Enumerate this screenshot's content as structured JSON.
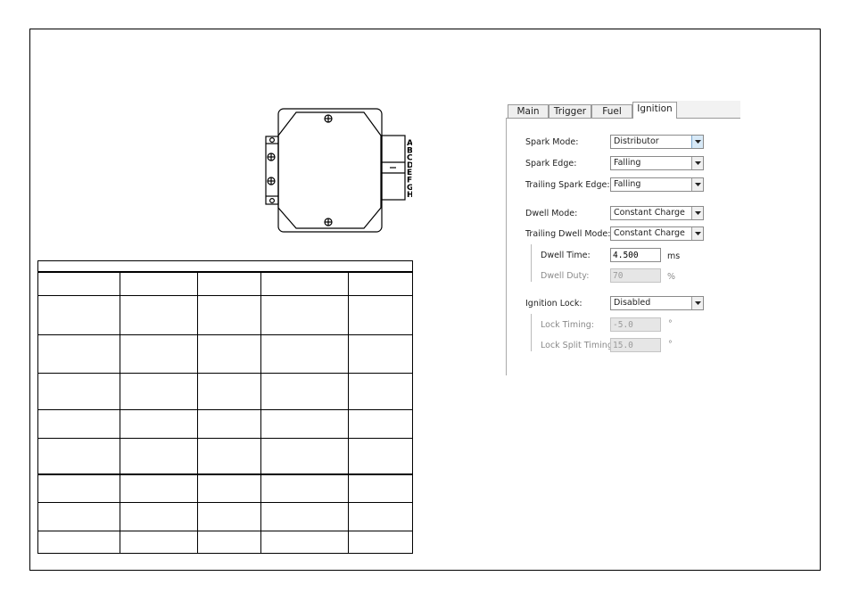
{
  "module": {
    "pin_letters": [
      "A",
      "B",
      "C",
      "D",
      "E",
      "F",
      "G",
      "H"
    ]
  },
  "pin_table": {
    "rows": 8,
    "cols": 5
  },
  "settings": {
    "tabs": [
      {
        "label": "Main"
      },
      {
        "label": "Trigger"
      },
      {
        "label": "Fuel"
      },
      {
        "label": "Ignition",
        "active": true
      }
    ],
    "spark_mode": {
      "label": "Spark Mode:",
      "value": "Distributor"
    },
    "spark_edge": {
      "label": "Spark Edge:",
      "value": "Falling"
    },
    "trailing_spark_edge": {
      "label": "Trailing Spark Edge:",
      "value": "Falling"
    },
    "dwell_mode": {
      "label": "Dwell Mode:",
      "value": "Constant Charge"
    },
    "trailing_dwell_mode": {
      "label": "Trailing Dwell Mode:",
      "value": "Constant Charge"
    },
    "dwell_time": {
      "label": "Dwell Time:",
      "value": "4.500",
      "unit": "ms"
    },
    "dwell_duty": {
      "label": "Dwell Duty:",
      "value": "70",
      "unit": "%",
      "disabled": true
    },
    "ignition_lock": {
      "label": "Ignition Lock:",
      "value": "Disabled"
    },
    "lock_timing": {
      "label": "Lock Timing:",
      "value": "-5.0",
      "unit": "°",
      "disabled": true
    },
    "lock_split_timing": {
      "label": "Lock Split Timing:",
      "value": "15.0",
      "unit": "°",
      "disabled": true
    }
  },
  "colors": {
    "tab_border": "#999999",
    "disabled_text": "#8a8a8a",
    "disabled_field": "#e6e6e6",
    "dropdown_highlight": "#d7e9f7"
  }
}
